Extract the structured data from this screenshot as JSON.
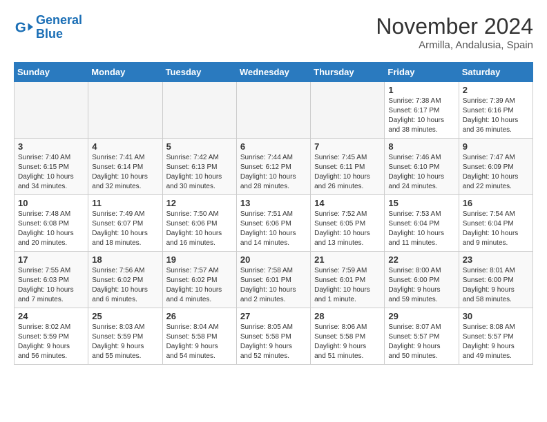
{
  "header": {
    "logo_line1": "General",
    "logo_line2": "Blue",
    "month": "November 2024",
    "location": "Armilla, Andalusia, Spain"
  },
  "columns": [
    "Sunday",
    "Monday",
    "Tuesday",
    "Wednesday",
    "Thursday",
    "Friday",
    "Saturday"
  ],
  "weeks": [
    [
      {
        "num": "",
        "detail": ""
      },
      {
        "num": "",
        "detail": ""
      },
      {
        "num": "",
        "detail": ""
      },
      {
        "num": "",
        "detail": ""
      },
      {
        "num": "",
        "detail": ""
      },
      {
        "num": "1",
        "detail": "Sunrise: 7:38 AM\nSunset: 6:17 PM\nDaylight: 10 hours\nand 38 minutes."
      },
      {
        "num": "2",
        "detail": "Sunrise: 7:39 AM\nSunset: 6:16 PM\nDaylight: 10 hours\nand 36 minutes."
      }
    ],
    [
      {
        "num": "3",
        "detail": "Sunrise: 7:40 AM\nSunset: 6:15 PM\nDaylight: 10 hours\nand 34 minutes."
      },
      {
        "num": "4",
        "detail": "Sunrise: 7:41 AM\nSunset: 6:14 PM\nDaylight: 10 hours\nand 32 minutes."
      },
      {
        "num": "5",
        "detail": "Sunrise: 7:42 AM\nSunset: 6:13 PM\nDaylight: 10 hours\nand 30 minutes."
      },
      {
        "num": "6",
        "detail": "Sunrise: 7:44 AM\nSunset: 6:12 PM\nDaylight: 10 hours\nand 28 minutes."
      },
      {
        "num": "7",
        "detail": "Sunrise: 7:45 AM\nSunset: 6:11 PM\nDaylight: 10 hours\nand 26 minutes."
      },
      {
        "num": "8",
        "detail": "Sunrise: 7:46 AM\nSunset: 6:10 PM\nDaylight: 10 hours\nand 24 minutes."
      },
      {
        "num": "9",
        "detail": "Sunrise: 7:47 AM\nSunset: 6:09 PM\nDaylight: 10 hours\nand 22 minutes."
      }
    ],
    [
      {
        "num": "10",
        "detail": "Sunrise: 7:48 AM\nSunset: 6:08 PM\nDaylight: 10 hours\nand 20 minutes."
      },
      {
        "num": "11",
        "detail": "Sunrise: 7:49 AM\nSunset: 6:07 PM\nDaylight: 10 hours\nand 18 minutes."
      },
      {
        "num": "12",
        "detail": "Sunrise: 7:50 AM\nSunset: 6:06 PM\nDaylight: 10 hours\nand 16 minutes."
      },
      {
        "num": "13",
        "detail": "Sunrise: 7:51 AM\nSunset: 6:06 PM\nDaylight: 10 hours\nand 14 minutes."
      },
      {
        "num": "14",
        "detail": "Sunrise: 7:52 AM\nSunset: 6:05 PM\nDaylight: 10 hours\nand 13 minutes."
      },
      {
        "num": "15",
        "detail": "Sunrise: 7:53 AM\nSunset: 6:04 PM\nDaylight: 10 hours\nand 11 minutes."
      },
      {
        "num": "16",
        "detail": "Sunrise: 7:54 AM\nSunset: 6:04 PM\nDaylight: 10 hours\nand 9 minutes."
      }
    ],
    [
      {
        "num": "17",
        "detail": "Sunrise: 7:55 AM\nSunset: 6:03 PM\nDaylight: 10 hours\nand 7 minutes."
      },
      {
        "num": "18",
        "detail": "Sunrise: 7:56 AM\nSunset: 6:02 PM\nDaylight: 10 hours\nand 6 minutes."
      },
      {
        "num": "19",
        "detail": "Sunrise: 7:57 AM\nSunset: 6:02 PM\nDaylight: 10 hours\nand 4 minutes."
      },
      {
        "num": "20",
        "detail": "Sunrise: 7:58 AM\nSunset: 6:01 PM\nDaylight: 10 hours\nand 2 minutes."
      },
      {
        "num": "21",
        "detail": "Sunrise: 7:59 AM\nSunset: 6:01 PM\nDaylight: 10 hours\nand 1 minute."
      },
      {
        "num": "22",
        "detail": "Sunrise: 8:00 AM\nSunset: 6:00 PM\nDaylight: 9 hours\nand 59 minutes."
      },
      {
        "num": "23",
        "detail": "Sunrise: 8:01 AM\nSunset: 6:00 PM\nDaylight: 9 hours\nand 58 minutes."
      }
    ],
    [
      {
        "num": "24",
        "detail": "Sunrise: 8:02 AM\nSunset: 5:59 PM\nDaylight: 9 hours\nand 56 minutes."
      },
      {
        "num": "25",
        "detail": "Sunrise: 8:03 AM\nSunset: 5:59 PM\nDaylight: 9 hours\nand 55 minutes."
      },
      {
        "num": "26",
        "detail": "Sunrise: 8:04 AM\nSunset: 5:58 PM\nDaylight: 9 hours\nand 54 minutes."
      },
      {
        "num": "27",
        "detail": "Sunrise: 8:05 AM\nSunset: 5:58 PM\nDaylight: 9 hours\nand 52 minutes."
      },
      {
        "num": "28",
        "detail": "Sunrise: 8:06 AM\nSunset: 5:58 PM\nDaylight: 9 hours\nand 51 minutes."
      },
      {
        "num": "29",
        "detail": "Sunrise: 8:07 AM\nSunset: 5:57 PM\nDaylight: 9 hours\nand 50 minutes."
      },
      {
        "num": "30",
        "detail": "Sunrise: 8:08 AM\nSunset: 5:57 PM\nDaylight: 9 hours\nand 49 minutes."
      }
    ]
  ]
}
